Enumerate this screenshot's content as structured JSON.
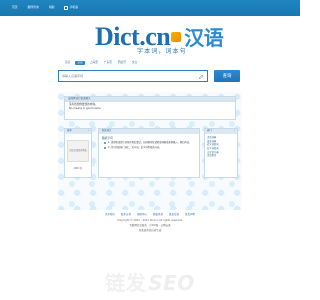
{
  "topbar": {
    "items": [
      "首页",
      "翻译查询",
      "捐助",
      "手机版"
    ]
  },
  "header": {
    "brand_left": "Dict.cn",
    "brand_right": "汉语",
    "tagline": "字本词，词本句"
  },
  "search": {
    "tabs": [
      "英汉",
      "汉英",
      "上海话",
      "广东话",
      "西班牙",
      "文言"
    ],
    "active_tab_index": 1,
    "placeholder": "请输入汉语字词",
    "button_label": "查询"
  },
  "result": {
    "head": "该简体词汇暂无释义",
    "line1": "没有找到你要找的内容。",
    "line2": "No means in good name"
  },
  "left_panel": {
    "title": "更多",
    "title_right": "›",
    "image_text": "汉语在线查询系统",
    "small": "(200 字)"
  },
  "mid_panel": {
    "title": "相关词汇",
    "sub": "随机字词",
    "rows": [
      "1. 请搜索或提示词条并稍后重试，如问题持续请检查网络或更换输入，稍后再试。",
      "2. 也可浏览热门词汇、近义词、反义词等相关内容。"
    ]
  },
  "right_panel": {
    "title": "热门",
    "title_right": "›",
    "items": [
      "汉语词典",
      "成语词典",
      "近义词查询",
      "反义词查询",
      "古汉语字典",
      "汉语拼音"
    ]
  },
  "footer": {
    "links": [
      "关于我们",
      "联系方式",
      "帮助中心",
      "隐私条款",
      "意见反馈",
      "免责声明"
    ],
    "line1": "Copyright © 2003 – 2024 Dict.cn All rights reserved.",
    "line2": "互联网信息服务 · 沪ICP备 · 公网安备",
    "line3": "页面由系统自动生成"
  },
  "watermark": {
    "left": "链发",
    "right": "SEO"
  }
}
